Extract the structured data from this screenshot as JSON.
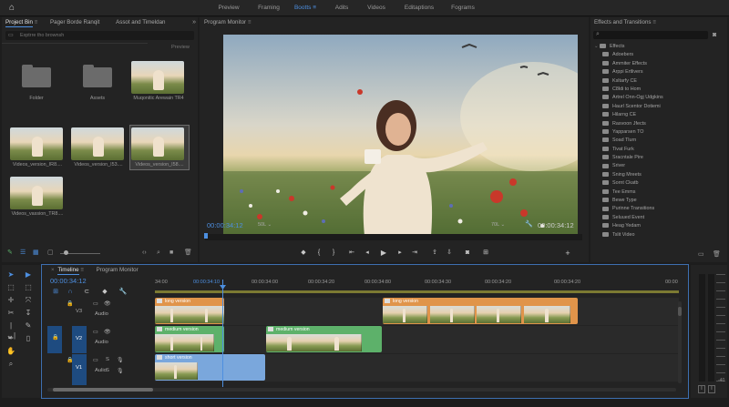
{
  "workspaces": [
    "Preview",
    "Framing",
    "Bootts",
    "Adits",
    "Videos",
    "Editaptions",
    "Fograms"
  ],
  "workspace_active_index": 2,
  "project_panel": {
    "tabs": [
      "Project Bin",
      "Pager Borde Ranqit",
      "Assot and Timeldan"
    ],
    "search_placeholder": "Exptrre tho brownsh",
    "preview_label": "Preview",
    "items": [
      {
        "label": "Folder",
        "kind": "folder"
      },
      {
        "label": "Assets",
        "kind": "folder"
      },
      {
        "label": "Muqonitic Arewain TR4",
        "kind": "clip"
      },
      {
        "label": "Videos_version_IR8....",
        "kind": "clip"
      },
      {
        "label": "Videos_version_I53....",
        "kind": "clip"
      },
      {
        "label": "Videos_version_I58....",
        "kind": "clip"
      },
      {
        "label": "Videos_vassion_TR8....",
        "kind": "clip"
      }
    ]
  },
  "program_monitor": {
    "title": "Program Monitor",
    "timecode_left": "00:00:34:12",
    "zoom": "50L",
    "quality": "70L",
    "timecode_right": "00:00:34:12"
  },
  "effects_panel": {
    "title": "Effects and Transitions",
    "root": "Effects",
    "items": [
      "Adoebers",
      "Ammiter Effects",
      "Arppi Ertlivers",
      "Ksltarfy CE",
      "C8ldi to Hom",
      "Artrel Onn-Ogj Udgkins",
      "Haurl Scentor Dotiemi",
      "Hilarng CE",
      "Rasvoon Jfects",
      "Yapparsen TO",
      "Soad Tlurn",
      "Tivat Furk",
      "Sracntale Pire",
      "Sriver",
      "Sning Mreets",
      "Sornt Ckatb",
      "Tee Emms",
      "Bewe Type",
      "Purinne Transitions",
      "Seluued Event",
      "Heag Yedam",
      "Tslit Video"
    ]
  },
  "timeline": {
    "tabs": [
      "Timeline",
      "Program Monitor"
    ],
    "timecode": "00:00:34:12",
    "ruler": [
      "34:00",
      "00:00:34:10",
      "00:00:34:00",
      "00:00:34:20",
      "00:00:34:80",
      "00:00:34:30",
      "00:00:34:20",
      "00:00:34:20",
      "00:00"
    ],
    "tracks": [
      {
        "id": "V3",
        "sub": "Audio"
      },
      {
        "id": "V2",
        "sub": "Audio"
      },
      {
        "id": "V1",
        "sub": "Aulio"
      }
    ],
    "clips": {
      "long_a": "long version",
      "long_b": "long version",
      "medium_a": "medium version",
      "medium_b": "medium version",
      "short": "short version"
    },
    "audio_meter_labels": [
      "S",
      "S"
    ],
    "meter_db_bottom": "-40"
  },
  "colors": {
    "accent": "#4d8fe0",
    "clip_orange": "#e0944a",
    "clip_green": "#5db16a",
    "clip_blue": "#7aa7dc"
  }
}
